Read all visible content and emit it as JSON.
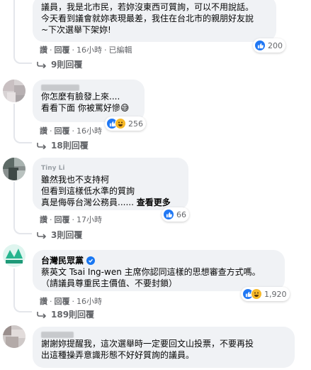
{
  "comments": [
    {
      "author": "",
      "text": "議員，我是北市民，若妳沒東西可質詢，可以不用說話。\n今天看到議會就妳表現最差，我住在台北市的親朋好友說\n~下次選舉下架妳!",
      "actions": {
        "like": "讚",
        "reply": "回覆",
        "time": "16小時",
        "edited": "已編輯"
      },
      "reactions": {
        "count": "200",
        "icons": [
          "like-icon"
        ]
      },
      "replies_label": "9則回覆"
    },
    {
      "author": "",
      "text": "你怎麼有臉發上來....\n看看下面 你被罵好慘😅",
      "actions": {
        "like": "讚",
        "reply": "回覆",
        "time": "16小時"
      },
      "reactions": {
        "count": "256",
        "icons": [
          "like-icon",
          "haha-icon"
        ]
      },
      "replies_label": "18則回覆"
    },
    {
      "author": "Tiny Li",
      "text": "雖然我也不支持柯\n但看到這樣低水準的質詢\n真是侮辱台灣公務員......",
      "see_more": "查看更多",
      "actions": {
        "like": "讚",
        "reply": "回覆",
        "time": "17小時"
      },
      "reactions": {
        "count": "66",
        "icons": [
          "like-icon"
        ]
      },
      "replies_label": "3則回覆"
    },
    {
      "author": "台灣民眾黨",
      "text": "蔡英文 Tsai Ing-wen 主席你認同這樣的思想審查方式嗎。\n（請議員尊重民主價值、不要封鎖）",
      "actions": {
        "like": "讚",
        "reply": "回覆",
        "time": "16小時"
      },
      "reactions": {
        "count": "1,920",
        "icons": [
          "like-icon",
          "haha-icon"
        ]
      },
      "replies_label": "189則回覆"
    },
    {
      "author": "",
      "text": "謝謝妳提醒我，這次選舉時一定要回文山投票，不要再投\n出這種操弄意識形態不好好質詢的議員。"
    }
  ],
  "colors": {
    "bubble": "#f0f2f5",
    "like": "#2078f4",
    "haha": "#f7b928",
    "muted": "#65676b",
    "verified": "#1877f2"
  }
}
